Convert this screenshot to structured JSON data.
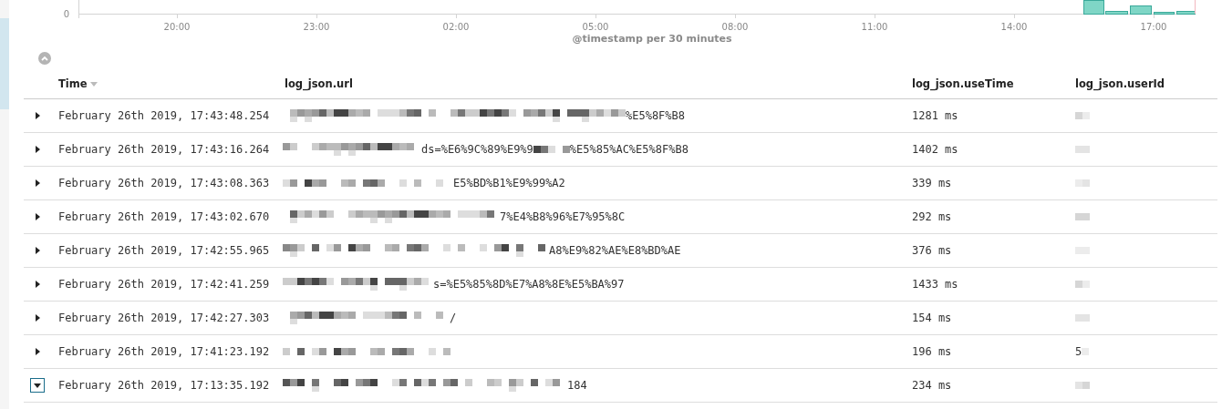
{
  "histogram": {
    "y_tick": "0",
    "x_ticks": [
      "20:00",
      "23:00",
      "02:00",
      "05:00",
      "08:00",
      "11:00",
      "14:00",
      "17:00"
    ],
    "xlabel": "@timestamp per 30 minutes"
  },
  "table": {
    "columns": [
      {
        "label": "Time",
        "sorted": true
      },
      {
        "label": "log_json.url",
        "sorted": false
      },
      {
        "label": "log_json.useTime",
        "sorted": false
      },
      {
        "label": "log_json.userId",
        "sorted": false
      }
    ],
    "rows": [
      {
        "expanded": false,
        "time": "February 26th 2019, 17:43:48.254",
        "url_parts": [
          "%E5%8F%B8"
        ],
        "use_time": "1281 ms"
      },
      {
        "expanded": false,
        "time": "February 26th 2019, 17:43:16.264",
        "url_parts": [
          "ds=%E6%9C%89%E9%9",
          "%E5%85%AC%E5%8F%B8"
        ],
        "use_time": "1402 ms"
      },
      {
        "expanded": false,
        "time": "February 26th 2019, 17:43:08.363",
        "url_parts": [
          "E5%BD%B1%E9%99%A2"
        ],
        "use_time": "339 ms"
      },
      {
        "expanded": false,
        "time": "February 26th 2019, 17:43:02.670",
        "url_parts": [
          "7%E4%B8%96%E7%95%8C"
        ],
        "use_time": "292 ms"
      },
      {
        "expanded": false,
        "time": "February 26th 2019, 17:42:55.965",
        "url_parts": [
          "A8%E9%82%AE%E8%BD%AE"
        ],
        "use_time": "376 ms"
      },
      {
        "expanded": false,
        "time": "February 26th 2019, 17:42:41.259",
        "url_parts": [
          "s=%E5%85%8D%E7%A8%8E%E5%BA%97"
        ],
        "use_time": "1433 ms"
      },
      {
        "expanded": false,
        "time": "February 26th 2019, 17:42:27.303",
        "url_parts": [
          "/"
        ],
        "use_time": "154 ms"
      },
      {
        "expanded": false,
        "time": "February 26th 2019, 17:41:23.192",
        "use_time": "196 ms",
        "user_id": "5"
      },
      {
        "expanded": true,
        "time": "February 26th 2019, 17:13:35.192",
        "url_parts": [
          "184"
        ],
        "use_time": "234 ms"
      }
    ]
  }
}
